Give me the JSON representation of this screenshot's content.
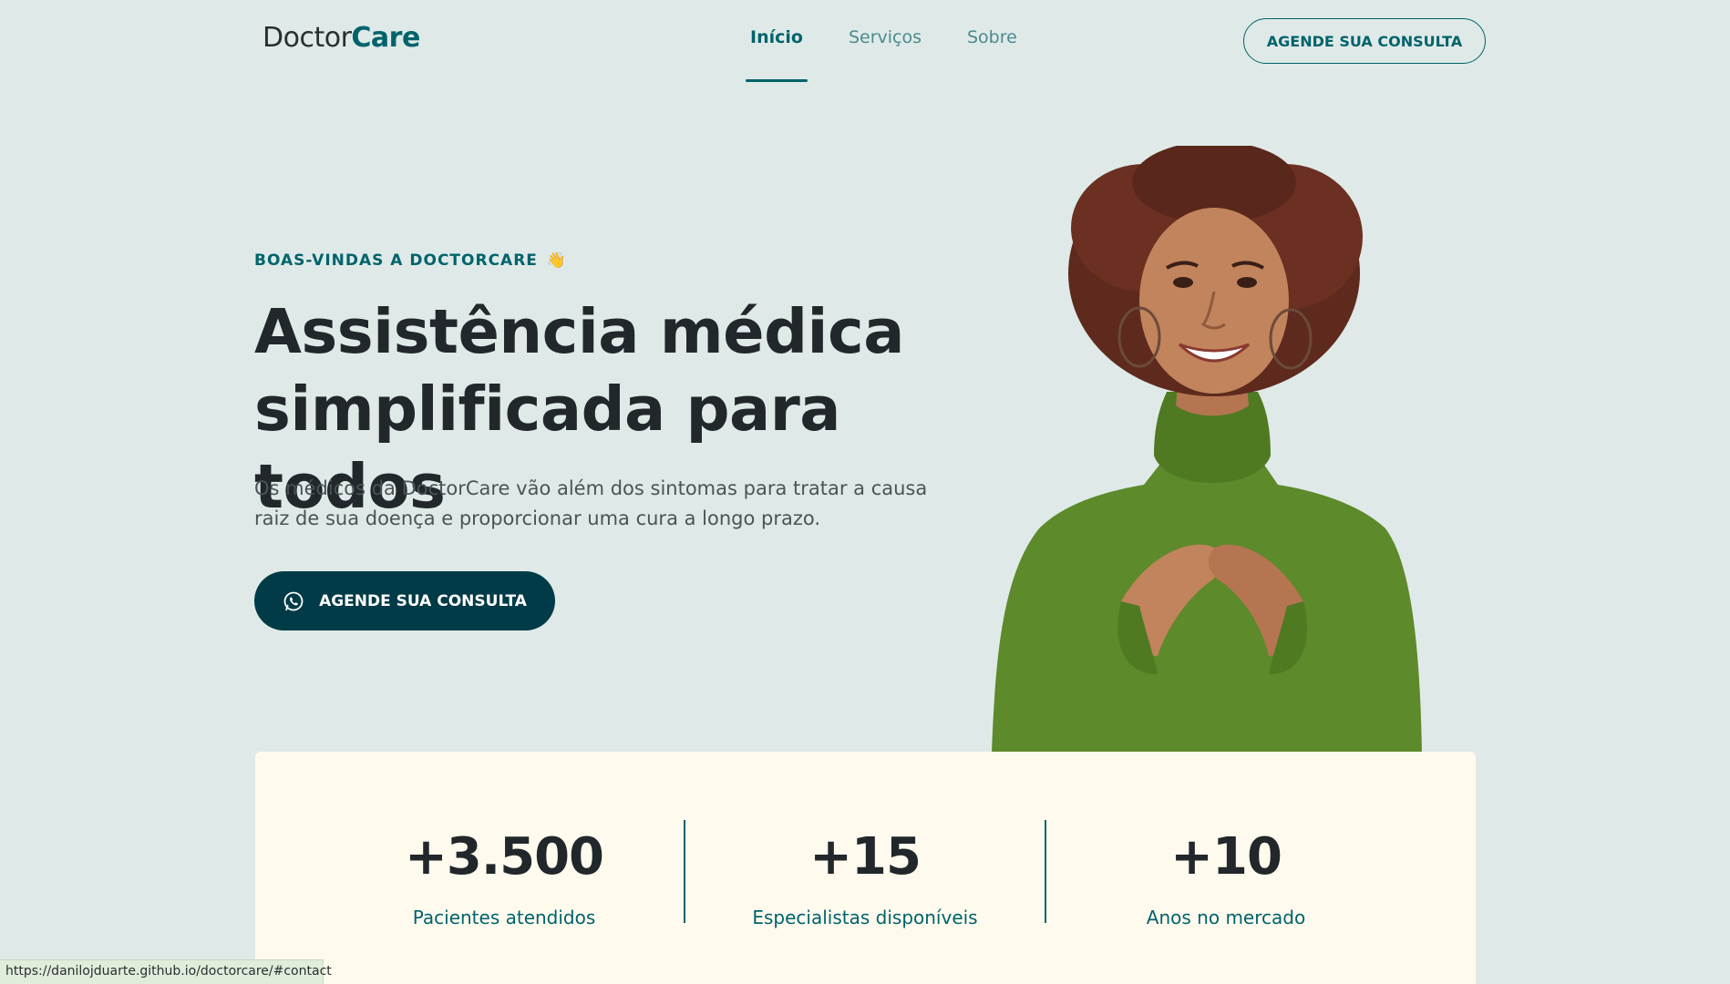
{
  "header": {
    "logo_prefix": "Doctor",
    "logo_suffix": "Care",
    "nav": [
      {
        "label": "Início",
        "active": true
      },
      {
        "label": "Serviços",
        "active": false
      },
      {
        "label": "Sobre",
        "active": false
      }
    ],
    "cta_label": "AGENDE SUA CONSULTA"
  },
  "hero": {
    "eyebrow": "BOAS-VINDAS A DOCTORCARE",
    "eyebrow_emoji": "👋",
    "title_line1": "Assistência médica",
    "title_line2": "simplificada para todos",
    "description": "Os médicos da DoctorCare vão além dos sintomas para tratar a causa raiz de sua doença e proporcionar uma cura a longo prazo.",
    "cta_label": "AGENDE SUA CONSULTA",
    "cta_icon": "whatsapp-icon"
  },
  "stats": [
    {
      "value": "+3.500",
      "label": "Pacientes atendidos"
    },
    {
      "value": "+15",
      "label": "Especialistas disponíveis"
    },
    {
      "value": "+10",
      "label": "Anos no mercado"
    }
  ],
  "status_bar": {
    "url": "https://danilojduarte.github.io/doctorcare/#contact"
  },
  "colors": {
    "background": "#dfeae8",
    "brand": "#00636b",
    "brand_dark": "#003b47",
    "stats_bg": "#fffaee",
    "text_dark": "#21272a"
  }
}
